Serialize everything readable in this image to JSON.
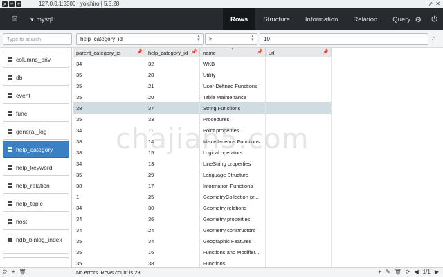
{
  "window": {
    "title": "127.0.0.1:3306 | yoichiro | 5.5.28",
    "buttons": [
      "×",
      "−",
      "+"
    ]
  },
  "toolbar": {
    "database": "mysql",
    "tabs": [
      "Rows",
      "Structure",
      "Information",
      "Relation",
      "Query"
    ],
    "active_tab": "Rows"
  },
  "filter": {
    "search_placeholder": "Type to search",
    "column": "help_category_id",
    "operator": ">",
    "value": "10"
  },
  "sidebar": {
    "items": [
      {
        "label": "columns_priv",
        "active": false
      },
      {
        "label": "db",
        "active": false
      },
      {
        "label": "event",
        "active": false
      },
      {
        "label": "func",
        "active": false
      },
      {
        "label": "general_log",
        "active": false
      },
      {
        "label": "help_category",
        "active": true
      },
      {
        "label": "help_keyword",
        "active": false
      },
      {
        "label": "help_relation",
        "active": false
      },
      {
        "label": "help_topic",
        "active": false
      },
      {
        "label": "host",
        "active": false
      },
      {
        "label": "ndb_binlog_index",
        "active": false
      }
    ]
  },
  "table": {
    "columns": [
      "parent_category_id",
      "help_category_id",
      "name",
      "url"
    ],
    "selected_row": 4,
    "rows": [
      [
        "34",
        "32",
        "WKB",
        ""
      ],
      [
        "35",
        "28",
        "Utility",
        ""
      ],
      [
        "35",
        "21",
        "User-Defined Functions",
        ""
      ],
      [
        "35",
        "20",
        "Table Maintenance",
        ""
      ],
      [
        "38",
        "37",
        "String Functions",
        ""
      ],
      [
        "35",
        "33",
        "Procedures",
        ""
      ],
      [
        "34",
        "11",
        "Point properties",
        ""
      ],
      [
        "38",
        "14",
        "Miscellaneous Functions",
        ""
      ],
      [
        "38",
        "15",
        "Logical operators",
        ""
      ],
      [
        "34",
        "13",
        "LineString properties",
        ""
      ],
      [
        "35",
        "29",
        "Language Structure",
        ""
      ],
      [
        "38",
        "17",
        "Information Functions",
        ""
      ],
      [
        "1",
        "25",
        "GeometryCollection pr...",
        ""
      ],
      [
        "34",
        "30",
        "Geometry relations",
        ""
      ],
      [
        "34",
        "36",
        "Geometry properties",
        ""
      ],
      [
        "34",
        "24",
        "Geometry constructors",
        ""
      ],
      [
        "35",
        "34",
        "Geographic Features",
        ""
      ],
      [
        "35",
        "16",
        "Functions and Modifier...",
        ""
      ],
      [
        "35",
        "38",
        "Functions",
        ""
      ]
    ]
  },
  "watermark": "chajian5.com",
  "status": {
    "message": "No errors. Rows count is 29",
    "page": "1/1"
  }
}
